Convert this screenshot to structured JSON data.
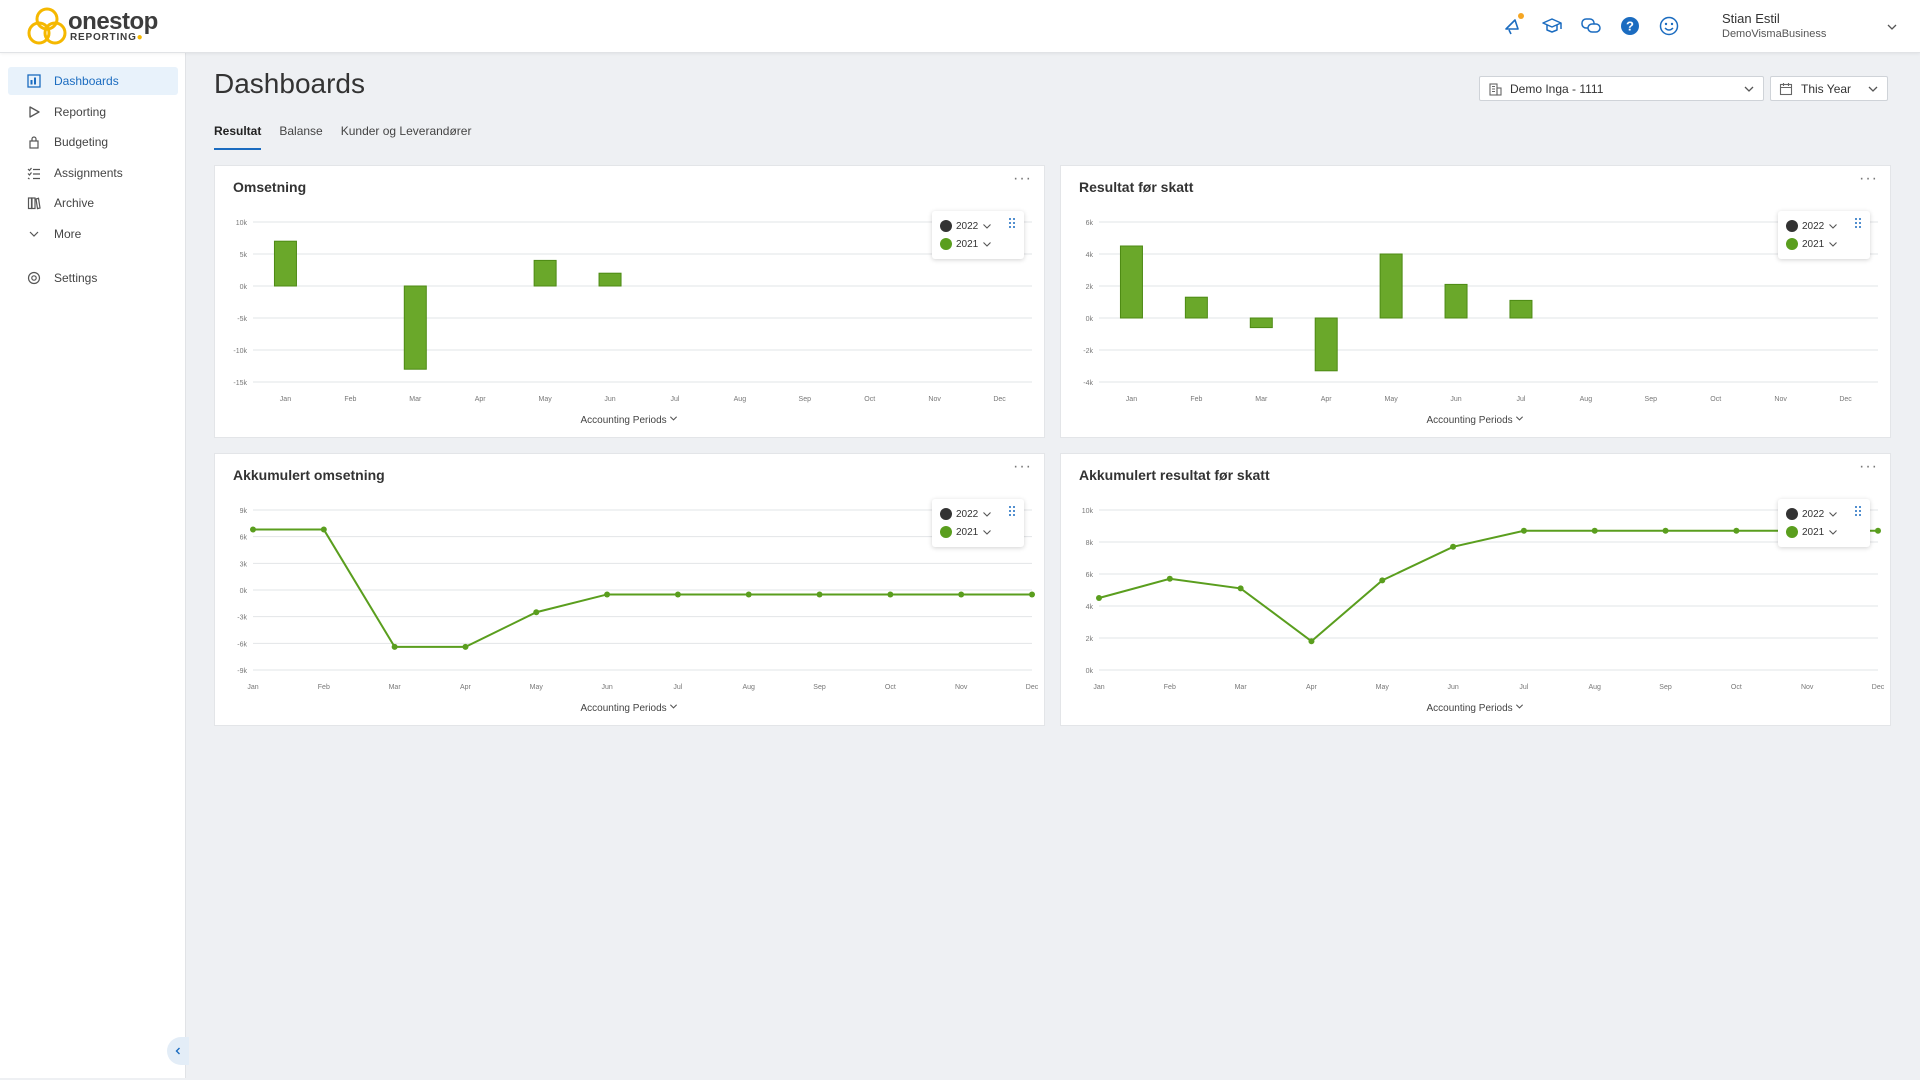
{
  "brand": {
    "name": "onestop",
    "sub": "REPORTING",
    "accent": "#f5b800"
  },
  "header": {
    "icons": [
      "megaphone-icon",
      "graduation-cap-icon",
      "chat-icon",
      "help-icon",
      "smiley-icon"
    ],
    "user_name": "Stian Estil",
    "user_company": "DemoVismaBusiness"
  },
  "sidebar": {
    "items": [
      {
        "label": "Dashboards",
        "icon": "dashboard-icon"
      },
      {
        "label": "Reporting",
        "icon": "play-icon"
      },
      {
        "label": "Budgeting",
        "icon": "lock-icon"
      },
      {
        "label": "Assignments",
        "icon": "checklist-icon"
      },
      {
        "label": "Archive",
        "icon": "books-icon"
      },
      {
        "label": "More",
        "icon": "chevron-down-icon"
      },
      {
        "label": "Settings",
        "icon": "gear-icon"
      }
    ]
  },
  "page": {
    "title": "Dashboards",
    "tabs": [
      "Resultat",
      "Balanse",
      "Kunder og Leverandører"
    ],
    "company_selector": "Demo Inga - 1111",
    "period_selector": "This Year"
  },
  "colors": {
    "series_2022": "#333333",
    "series_2021": "#5a9e1e",
    "accent": "#1b6cc0"
  },
  "chart_data": [
    {
      "type": "bar",
      "title": "Omsetning",
      "xlabel": "Accounting Periods",
      "categories": [
        "Jan",
        "Feb",
        "Mar",
        "Apr",
        "May",
        "Jun",
        "Jul",
        "Aug",
        "Sep",
        "Oct",
        "Nov",
        "Dec"
      ],
      "yticks": [
        "10k",
        "5k",
        "0k",
        "-5k",
        "-10k",
        "-15k"
      ],
      "ylim": [
        -15000,
        10000
      ],
      "legend": [
        "2022",
        "2021"
      ],
      "series": [
        {
          "name": "2021",
          "values": [
            7000,
            0,
            -13000,
            0,
            4000,
            2000,
            0,
            0,
            0,
            0,
            0,
            0
          ]
        }
      ]
    },
    {
      "type": "bar",
      "title": "Resultat før skatt",
      "xlabel": "Accounting Periods",
      "categories": [
        "Jan",
        "Feb",
        "Mar",
        "Apr",
        "May",
        "Jun",
        "Jul",
        "Aug",
        "Sep",
        "Oct",
        "Nov",
        "Dec"
      ],
      "yticks": [
        "6k",
        "4k",
        "2k",
        "0k",
        "-2k",
        "-4k"
      ],
      "ylim": [
        -4000,
        6000
      ],
      "legend": [
        "2022",
        "2021"
      ],
      "series": [
        {
          "name": "2021",
          "values": [
            4500,
            1300,
            -600,
            -3300,
            4000,
            2100,
            1100,
            0,
            0,
            0,
            0,
            0
          ]
        }
      ]
    },
    {
      "type": "line",
      "title": "Akkumulert omsetning",
      "xlabel": "Accounting Periods",
      "categories": [
        "Jan",
        "Feb",
        "Mar",
        "Apr",
        "May",
        "Jun",
        "Jul",
        "Aug",
        "Sep",
        "Oct",
        "Nov",
        "Dec"
      ],
      "yticks": [
        "9k",
        "6k",
        "3k",
        "0k",
        "-3k",
        "-6k",
        "-9k"
      ],
      "ylim": [
        -9000,
        9000
      ],
      "legend": [
        "2022",
        "2021"
      ],
      "series": [
        {
          "name": "2021",
          "values": [
            6800,
            6800,
            -6400,
            -6400,
            -2500,
            -500,
            -500,
            -500,
            -500,
            -500,
            -500,
            -500
          ]
        }
      ]
    },
    {
      "type": "line",
      "title": "Akkumulert resultat før skatt",
      "xlabel": "Accounting Periods",
      "categories": [
        "Jan",
        "Feb",
        "Mar",
        "Apr",
        "May",
        "Jun",
        "Jul",
        "Aug",
        "Sep",
        "Oct",
        "Nov",
        "Dec"
      ],
      "yticks": [
        "10k",
        "8k",
        "6k",
        "4k",
        "2k",
        "0k"
      ],
      "ylim": [
        0,
        10000
      ],
      "legend": [
        "2022",
        "2021"
      ],
      "series": [
        {
          "name": "2021",
          "values": [
            4500,
            5700,
            5100,
            1800,
            5600,
            7700,
            8700,
            8700,
            8700,
            8700,
            8700,
            8700
          ]
        }
      ]
    }
  ]
}
